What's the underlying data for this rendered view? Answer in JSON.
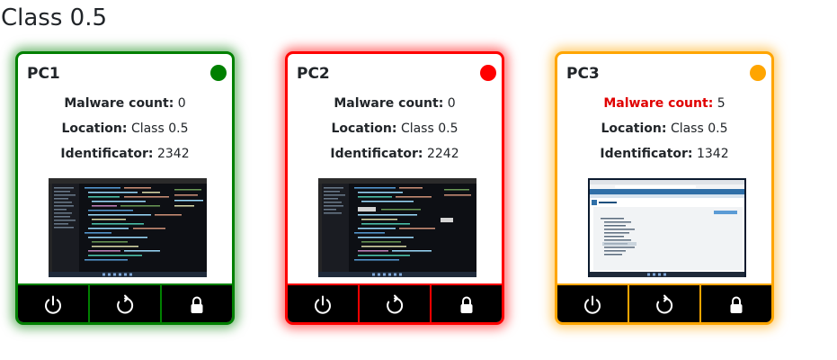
{
  "page": {
    "title": "Class 0.5"
  },
  "labels": {
    "malware": "Malware count:",
    "location": "Location:",
    "identificator": "Identificator:"
  },
  "pcs": [
    {
      "name": "PC1",
      "status_color": "#008000",
      "malware_count": "0",
      "location": "Class 0.5",
      "identificator": "2342",
      "screen_theme": "dark-code-editor"
    },
    {
      "name": "PC2",
      "status_color": "#ff0000",
      "malware_count": "0",
      "location": "Class 0.5",
      "identificator": "2242",
      "screen_theme": "dark-code-editor"
    },
    {
      "name": "PC3",
      "status_color": "#ffa500",
      "malware_count": "5",
      "malware_alert_color": "#e00000",
      "location": "Class 0.5",
      "identificator": "1342",
      "screen_theme": "light-browser-document"
    }
  ],
  "actions": [
    {
      "icon": "power-icon"
    },
    {
      "icon": "restart-icon"
    },
    {
      "icon": "lock-icon"
    }
  ]
}
